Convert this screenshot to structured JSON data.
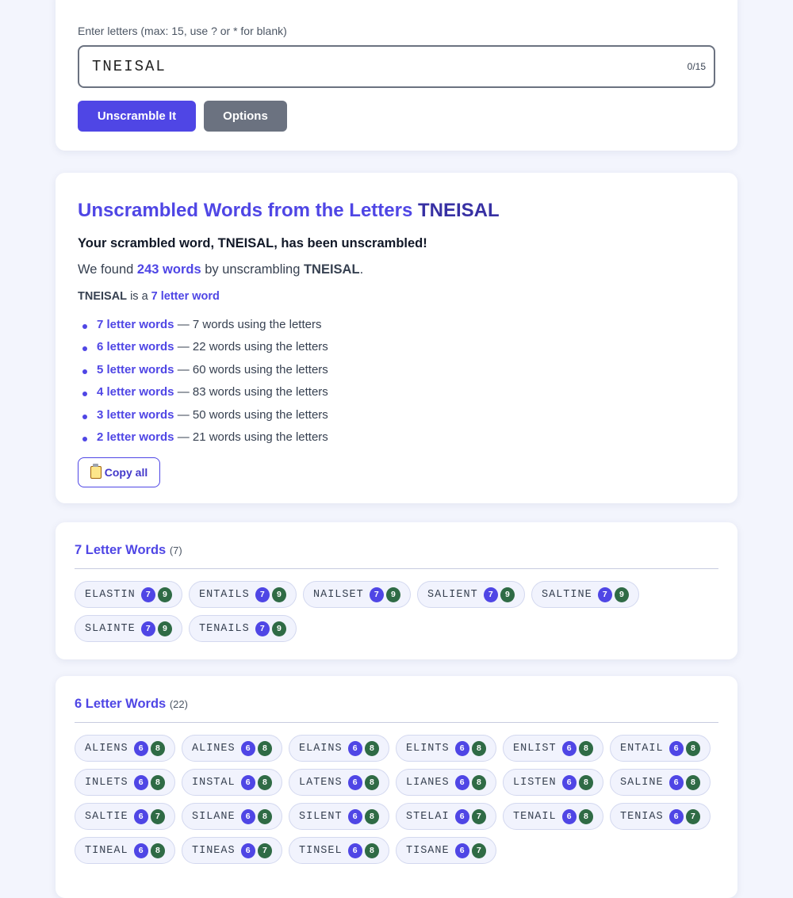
{
  "search": {
    "label": "Enter letters (max: 15, use ? or * for blank)",
    "value": "TNEISAL",
    "counter": "0/15",
    "primary_button": "Unscramble It",
    "secondary_button": "Options"
  },
  "summary": {
    "title_prefix": "Unscrambled Words from the Letters",
    "title_letters": "TNEISAL",
    "line1_a": "Your scrambled word,",
    "line1_word": "TNEISAL",
    "line1_b": ", has been unscrambled!",
    "line2_a": "We found",
    "line2_count": "243 words",
    "line2_b": "by unscrambling",
    "line2_word": "TNEISAL",
    "line2_c": ".",
    "line3_word": "TNEISAL",
    "line3_a": "is a",
    "line3_link": "7 letter word",
    "lengths": [
      {
        "link": "7 letter words",
        "desc": "— 7 words using the letters"
      },
      {
        "link": "6 letter words",
        "desc": "— 22 words using the letters"
      },
      {
        "link": "5 letter words",
        "desc": "— 60 words using the letters"
      },
      {
        "link": "4 letter words",
        "desc": "— 83 words using the letters"
      },
      {
        "link": "3 letter words",
        "desc": "— 50 words using the letters"
      },
      {
        "link": "2 letter words",
        "desc": "— 21 words using the letters"
      }
    ],
    "copy_button": "Copy all",
    "copy_icon": "clipboard-icon"
  },
  "groups": [
    {
      "title": "7 Letter Words",
      "count": "(7)",
      "words": [
        {
          "word": "ELASTIN",
          "len": "7",
          "pts": "9"
        },
        {
          "word": "ENTAILS",
          "len": "7",
          "pts": "9"
        },
        {
          "word": "NAILSET",
          "len": "7",
          "pts": "9"
        },
        {
          "word": "SALIENT",
          "len": "7",
          "pts": "9"
        },
        {
          "word": "SALTINE",
          "len": "7",
          "pts": "9"
        },
        {
          "word": "SLAINTE",
          "len": "7",
          "pts": "9"
        },
        {
          "word": "TENAILS",
          "len": "7",
          "pts": "9"
        }
      ]
    },
    {
      "title": "6 Letter Words",
      "count": "(22)",
      "words": [
        {
          "word": "ALIENS",
          "len": "6",
          "pts": "8"
        },
        {
          "word": "ALINES",
          "len": "6",
          "pts": "8"
        },
        {
          "word": "ELAINS",
          "len": "6",
          "pts": "8"
        },
        {
          "word": "ELINTS",
          "len": "6",
          "pts": "8"
        },
        {
          "word": "ENLIST",
          "len": "6",
          "pts": "8"
        },
        {
          "word": "ENTAIL",
          "len": "6",
          "pts": "8"
        },
        {
          "word": "INLETS",
          "len": "6",
          "pts": "8"
        },
        {
          "word": "INSTAL",
          "len": "6",
          "pts": "8"
        },
        {
          "word": "LATENS",
          "len": "6",
          "pts": "8"
        },
        {
          "word": "LIANES",
          "len": "6",
          "pts": "8"
        },
        {
          "word": "LISTEN",
          "len": "6",
          "pts": "8"
        },
        {
          "word": "SALINE",
          "len": "6",
          "pts": "8"
        },
        {
          "word": "SALTIE",
          "len": "6",
          "pts": "7"
        },
        {
          "word": "SILANE",
          "len": "6",
          "pts": "8"
        },
        {
          "word": "SILENT",
          "len": "6",
          "pts": "8"
        },
        {
          "word": "STELAI",
          "len": "6",
          "pts": "7"
        },
        {
          "word": "TENAIL",
          "len": "6",
          "pts": "8"
        },
        {
          "word": "TENIAS",
          "len": "6",
          "pts": "7"
        },
        {
          "word": "TINEAL",
          "len": "6",
          "pts": "8"
        },
        {
          "word": "TINEAS",
          "len": "6",
          "pts": "7"
        },
        {
          "word": "TINSEL",
          "len": "6",
          "pts": "8"
        },
        {
          "word": "TISANE",
          "len": "6",
          "pts": "7"
        }
      ]
    }
  ],
  "colors": {
    "accent": "#4f46e5",
    "points_badge": "#2f6b45",
    "secondary_button": "#6b7280",
    "background": "#f3f5fd"
  }
}
